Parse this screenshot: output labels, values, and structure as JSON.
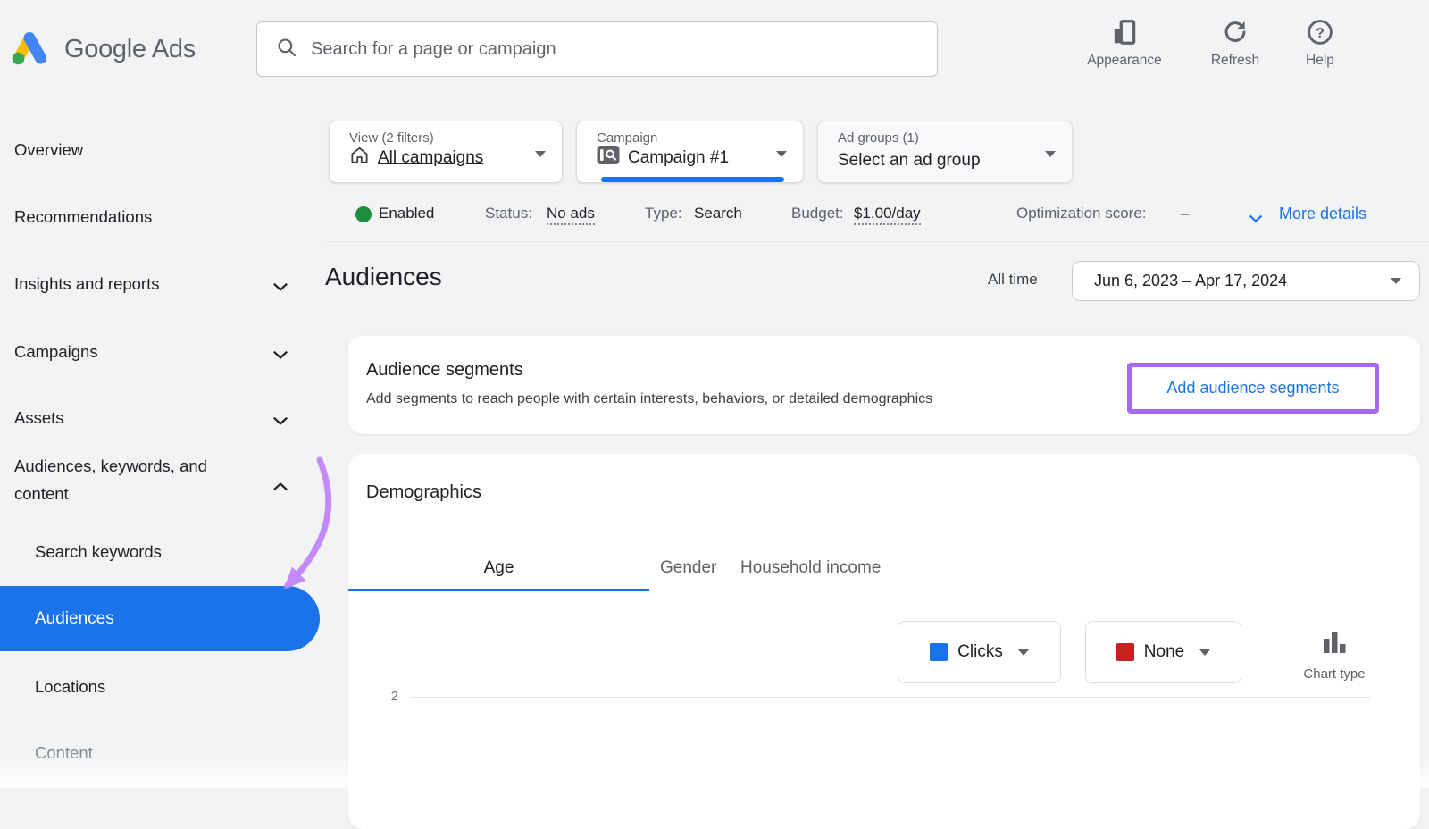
{
  "topbar": {
    "brand": "Google Ads",
    "search": {
      "placeholder": "Search for a page or campaign"
    },
    "actions": [
      {
        "label": "Appearance"
      },
      {
        "label": "Refresh"
      },
      {
        "label": "Help"
      }
    ]
  },
  "sidebar": {
    "items": [
      {
        "label": "Overview"
      },
      {
        "label": "Recommendations"
      },
      {
        "label": "Insights and reports"
      },
      {
        "label": "Campaigns"
      },
      {
        "label": "Assets"
      },
      {
        "label": "Audiences, keywords, and content"
      }
    ],
    "sub_items": [
      {
        "label": "Search keywords"
      },
      {
        "label": "Audiences",
        "active": true
      },
      {
        "label": "Locations"
      },
      {
        "label": "Content"
      }
    ]
  },
  "filters": {
    "view": {
      "label": "View (2 filters)",
      "value": "All campaigns"
    },
    "campaign": {
      "label": "Campaign",
      "value": "Campaign #1"
    },
    "ad_groups": {
      "label": "Ad groups (1)",
      "value": "Select an ad group"
    }
  },
  "status_bar": {
    "state": "Enabled",
    "status_label": "Status:",
    "status_value": "No ads",
    "type_label": "Type:",
    "type_value": "Search",
    "budget_label": "Budget:",
    "budget_value": "$1.00/day",
    "optimization_label": "Optimization score:",
    "optimization_value": "–",
    "more_details": "More details"
  },
  "page_header": {
    "title": "Audiences",
    "range_shortcut": "All time",
    "date_range": "Jun 6, 2023 – Apr 17, 2024"
  },
  "audience_segments": {
    "title": "Audience segments",
    "description": "Add segments to reach people with certain interests, behaviors, or detailed demographics",
    "cta": "Add audience segments"
  },
  "demographics": {
    "title": "Demographics",
    "tabs": [
      {
        "label": "Age",
        "active": true
      },
      {
        "label": "Gender"
      },
      {
        "label": "Household income"
      }
    ],
    "primary_metric": "Clicks",
    "secondary_metric": "None",
    "chart_type_label": "Chart type",
    "y_axis_tick": "2"
  },
  "colors": {
    "accent_blue": "#1a73e8",
    "enabled_green": "#1e8e3e",
    "metric_primary_swatch": "#1a73e8",
    "metric_secondary_swatch": "#c5221f",
    "annotation_box_purple": "#a56af2",
    "annotation_arrow_purple": "#c58af9"
  }
}
